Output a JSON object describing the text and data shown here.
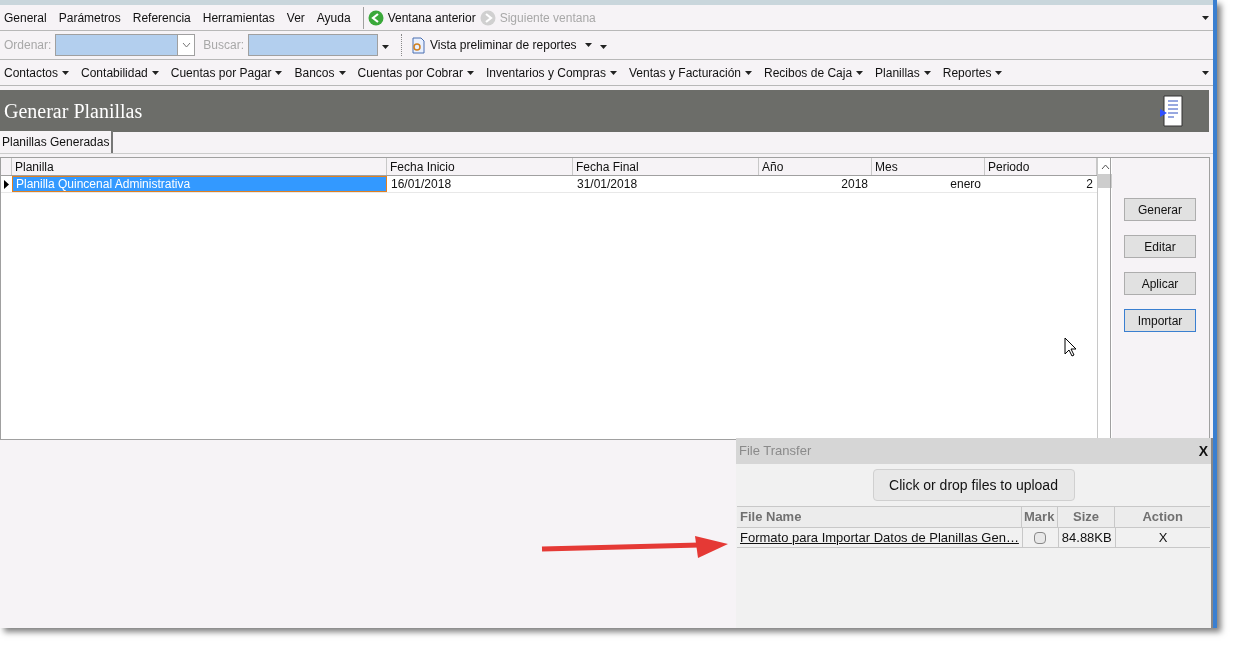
{
  "main_menu": [
    "General",
    "Parámetros",
    "Referencia",
    "Herramientas",
    "Ver",
    "Ayuda"
  ],
  "navigation": [
    {
      "label": "Ventana anterior",
      "disabled": false
    },
    {
      "label": "Siguiente ventana",
      "disabled": true
    }
  ],
  "toolbar": {
    "sort_label": "Ordenar:",
    "search_label": "Buscar:",
    "report_preview": "Vista preliminar de reportes"
  },
  "module_menu": [
    "Contactos",
    "Contabilidad",
    "Cuentas por Pagar",
    "Bancos",
    "Cuentas por Cobrar",
    "Inventarios y Compras",
    "Ventas y Facturación",
    "Recibos de Caja",
    "Planillas",
    "Reportes"
  ],
  "header": {
    "title": "Generar Planillas"
  },
  "tabs": [
    {
      "label": "Planillas Generadas",
      "selected": true
    }
  ],
  "table": {
    "columns": [
      {
        "label": "Planilla"
      },
      {
        "label": "Fecha Inicio"
      },
      {
        "label": "Fecha Final"
      },
      {
        "label": "Año"
      },
      {
        "label": "Mes"
      },
      {
        "label": "Periodo"
      }
    ],
    "rows": [
      {
        "selected": true,
        "cells": [
          "Planilla Quincenal Administrativa",
          "16/01/2018",
          "31/01/2018",
          "2018",
          "enero",
          "2"
        ]
      }
    ]
  },
  "buttons": [
    {
      "label": "Generar",
      "focused": false
    },
    {
      "label": "Editar",
      "focused": false
    },
    {
      "label": "Aplicar",
      "focused": false
    },
    {
      "label": "Importar",
      "focused": true
    }
  ],
  "file_transfer": {
    "title": "File Transfer",
    "close": "X",
    "upload_button": "Click or drop files to upload",
    "columns": [
      "File Name",
      "Mark",
      "Size",
      "Action"
    ],
    "files": [
      {
        "name": "Formato para Importar Datos de Planillas Gen…",
        "checked": false,
        "size": "84.88KB",
        "action": "X"
      }
    ]
  }
}
